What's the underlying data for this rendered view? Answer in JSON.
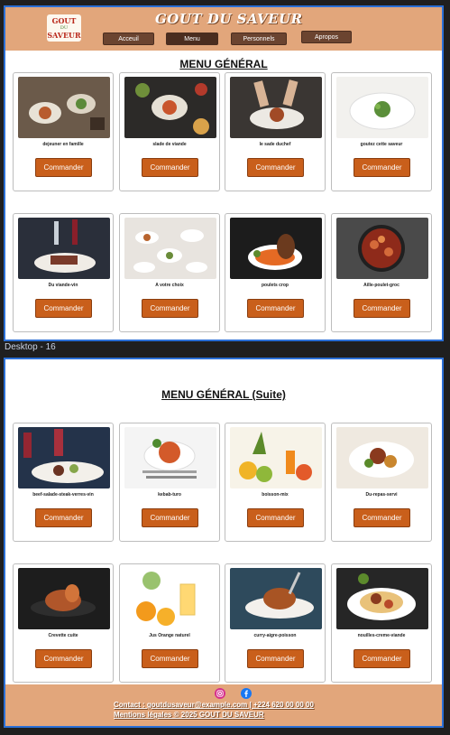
{
  "frame_label": "Desktop - 16",
  "header": {
    "title": "GOUT DU SAVEUR",
    "logo_text": [
      "GOUT",
      "DU",
      "SAVEUR"
    ],
    "nav": [
      "Acceuil",
      "Menu",
      "Personnels",
      "Apropos"
    ]
  },
  "section1": {
    "title": "MENU GÉNÉRAL",
    "items": [
      {
        "name": "dejeuner en famille",
        "button": "Commander"
      },
      {
        "name": "slade de viande",
        "button": "Commander"
      },
      {
        "name": "le sade duchef",
        "button": "Commander"
      },
      {
        "name": "goutez cette saveur",
        "button": "Commander"
      },
      {
        "name": "Du viande-vin",
        "button": "Commander"
      },
      {
        "name": "A votre choix",
        "button": "Commander"
      },
      {
        "name": "poulets crop",
        "button": "Commander"
      },
      {
        "name": "Aille-poulet-groc",
        "button": "Commander"
      }
    ]
  },
  "section2": {
    "title": "MENU GÉNÉRAL (Suite)",
    "items": [
      {
        "name": "beef-salade-steak-verres-vin",
        "button": "Commander"
      },
      {
        "name": "kebab-turo",
        "button": "Commander"
      },
      {
        "name": "boisson-mix",
        "button": "Commander"
      },
      {
        "name": "Du-repas-servi",
        "button": "Commander"
      },
      {
        "name": "Crevette cuite",
        "button": "Commander"
      },
      {
        "name": "Jus Orange naturel",
        "button": "Commander"
      },
      {
        "name": "curry-aigre-poisson",
        "button": "Commander"
      },
      {
        "name": "nouilles-creme-viande",
        "button": "Commander"
      }
    ]
  },
  "footer": {
    "contact": "Contact : goutdusaveur@example.com | +224 620 00 00 00",
    "legal": "Mentions légales © 2025 GOUT DU SAVEUR",
    "social_icons": [
      "instagram-icon",
      "facebook-icon"
    ]
  },
  "colors": {
    "header_bg": "#e2a67b",
    "button_bg": "#c95f1b",
    "nav_bg": "#6b4430",
    "frame_border": "#2a6fd6"
  }
}
